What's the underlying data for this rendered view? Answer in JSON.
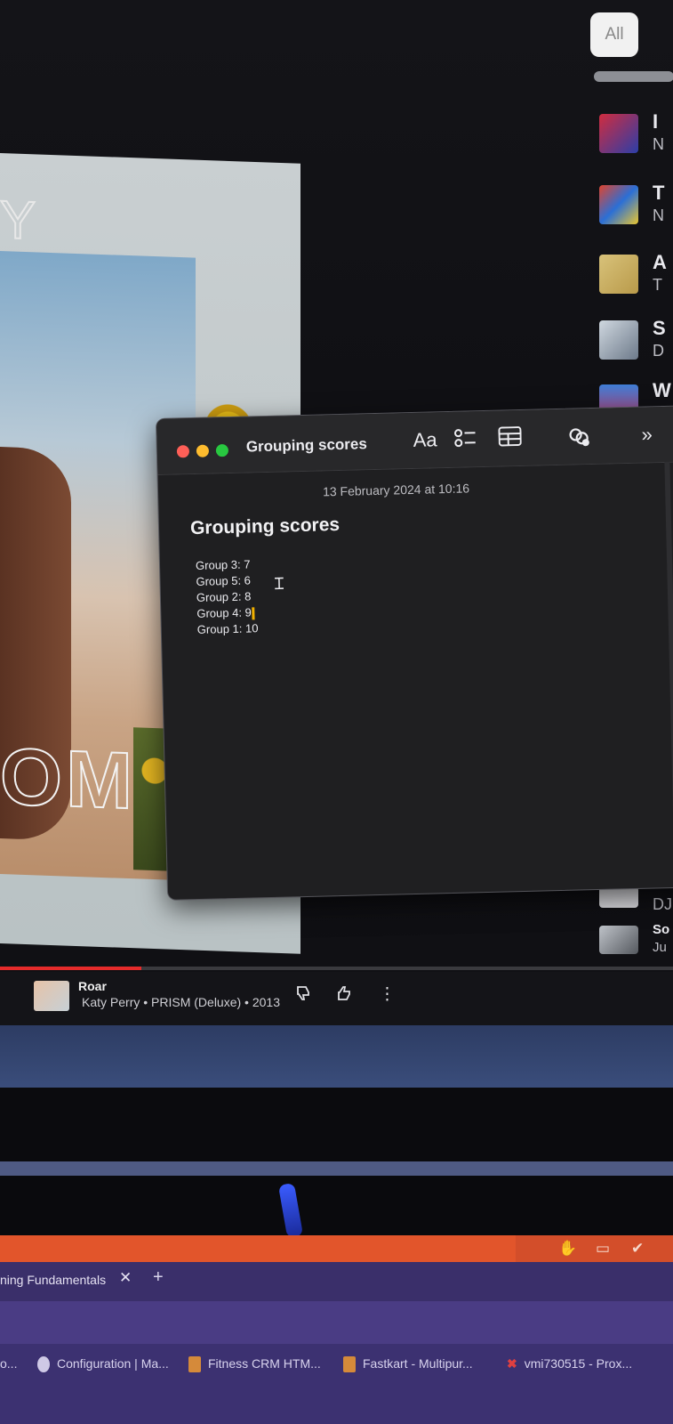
{
  "sidebar": {
    "filter_chip": "All",
    "items": [
      {
        "initial": "I",
        "sub": "N"
      },
      {
        "initial": "T",
        "sub": "N"
      },
      {
        "initial": "A",
        "sub": "T"
      },
      {
        "initial": "S",
        "sub": "D"
      },
      {
        "initial": "W",
        "sub": ""
      }
    ],
    "lower_items": [
      {
        "initial": "",
        "sub": "DJ"
      },
      {
        "initial": "So",
        "sub": "Ju"
      }
    ]
  },
  "album_art": {
    "letters": "OM",
    "top_letter": "Y"
  },
  "notes_window": {
    "title": "Grouping scores",
    "toolbar": {
      "font_label": "Aa",
      "more_label": "»"
    },
    "date": "13 February 2024 at 10:16",
    "note_title": "Grouping scores",
    "lines": [
      "Group  3: 7",
      "Group  5: 6",
      "Group  2: 8",
      "Group 4:  9",
      "Group 1: 10"
    ],
    "colors": {
      "close": "#fe5f57",
      "minimize": "#febc2e",
      "zoom": "#28c840"
    }
  },
  "player": {
    "progress": 0.21,
    "title": "Roar",
    "subtitle": "Katy Perry • PRISM (Deluxe) • 2013",
    "accent": "#e52b2b"
  },
  "browser": {
    "tab_label": "ning Fundamentals",
    "bookmarks": [
      "o...",
      "Configuration | Ma...",
      "Fitness CRM HTM...",
      "Fastkart - Multipur...",
      "vmi730515 - Prox..."
    ]
  }
}
